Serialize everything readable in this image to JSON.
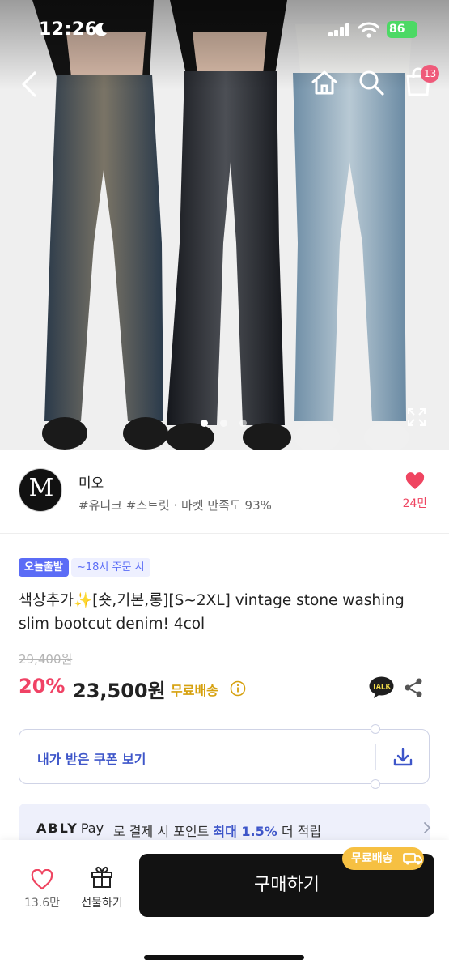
{
  "status_bar": {
    "time": "12:26",
    "battery": "86"
  },
  "header": {
    "cart_count": "13"
  },
  "gallery": {
    "total": 3,
    "active": 0
  },
  "seller": {
    "logo_letter": "M",
    "name": "미오",
    "tags": "#유니크 #스트릿 · 마켓 만족도 93%",
    "like_count": "24만"
  },
  "product": {
    "delivery_badge": "오늘출발",
    "delivery_note": "~18시 주문 시",
    "title": "색상추가✨[숏,기본,롱][S~2XL] vintage stone washing slim bootcut denim! 4col",
    "original_price": "29,400원",
    "discount": "20%",
    "price": "23,500원",
    "shipping": "무료배송"
  },
  "coupon": {
    "label": "내가 받은 쿠폰 보기"
  },
  "pay_banner": {
    "brand": "ABLY",
    "brand_suffix": "Pay",
    "text_before": "로 결제 시 포인트 ",
    "highlight": "최대 1.5%",
    "text_after": " 더 적립"
  },
  "bottom_bar": {
    "wish_count": "13.6만",
    "gift_label": "선물하기",
    "buy_label": "구매하기",
    "free_tag": "무료배송"
  },
  "colors": {
    "accent_pink": "#f04265",
    "accent_blue": "#3e56c9",
    "shipping_gold": "#d6a10f",
    "badge_purple": "#5b6cf6"
  },
  "icons": [
    "back-icon",
    "home-icon",
    "search-icon",
    "cart-icon",
    "expand-icon",
    "heart-icon",
    "info-icon",
    "kakaotalk-icon",
    "share-icon",
    "download-icon",
    "chevron-right-icon",
    "gift-icon",
    "truck-icon"
  ]
}
